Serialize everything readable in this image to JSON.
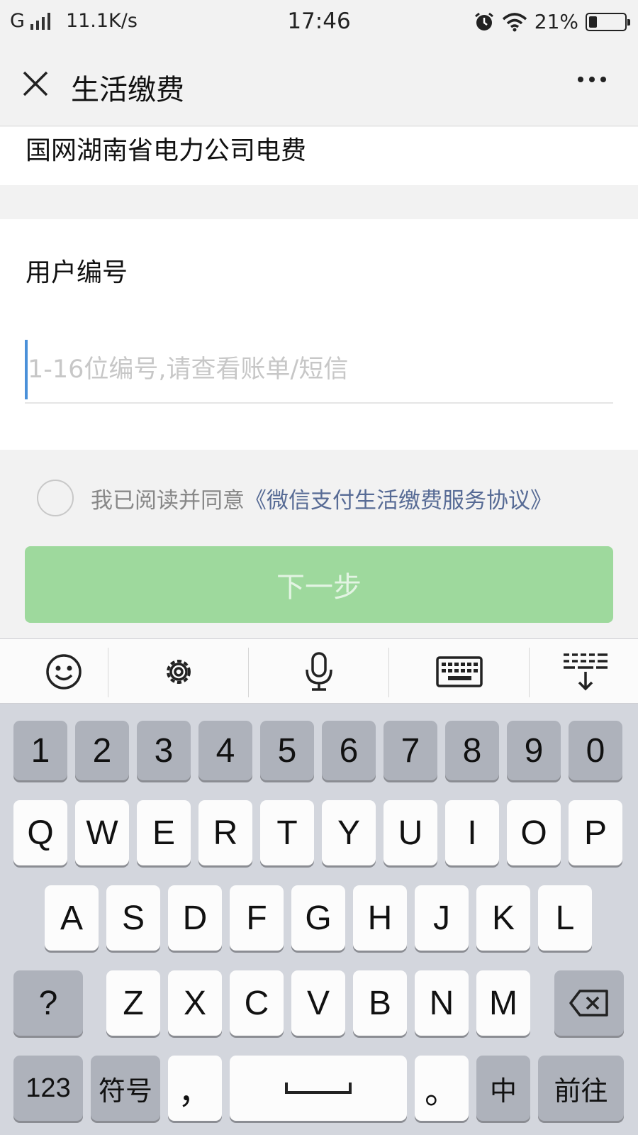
{
  "status_bar": {
    "network": "G",
    "speed": "11.1K/s",
    "time": "17:46",
    "battery": "21%",
    "battery_level": 0.21
  },
  "nav": {
    "title": "生活缴费"
  },
  "company": {
    "name": "国网湖南省电力公司电费"
  },
  "form": {
    "label": "用户编号",
    "value": "",
    "placeholder": "1-16位编号,请查看账单/短信"
  },
  "agreement": {
    "text": "我已阅读并同意",
    "link": "《微信支付生活缴费服务协议》",
    "checked": false
  },
  "next_button": {
    "label": "下一步",
    "enabled": false
  },
  "keyboard_toolbar": {
    "icons": [
      "emoji-icon",
      "settings-icon",
      "microphone-icon",
      "keyboard-icon",
      "hide-keyboard-icon"
    ]
  },
  "keyboard": {
    "number_row": [
      "1",
      "2",
      "3",
      "4",
      "5",
      "6",
      "7",
      "8",
      "9",
      "0"
    ],
    "row1": [
      "Q",
      "W",
      "E",
      "R",
      "T",
      "Y",
      "U",
      "I",
      "O",
      "P"
    ],
    "row2": [
      "A",
      "S",
      "D",
      "F",
      "G",
      "H",
      "J",
      "K",
      "L"
    ],
    "row3": [
      "Z",
      "X",
      "C",
      "V",
      "B",
      "N",
      "M"
    ],
    "question_key": "?",
    "numbers_key": "123",
    "symbols_key": "符号",
    "comma_key": "，",
    "period_key": "。",
    "ime_key": "中",
    "go_key": "前往"
  },
  "colors": {
    "accent_green": "#9ed99d",
    "link_blue": "#576b95",
    "caret_blue": "#4a90d9"
  }
}
